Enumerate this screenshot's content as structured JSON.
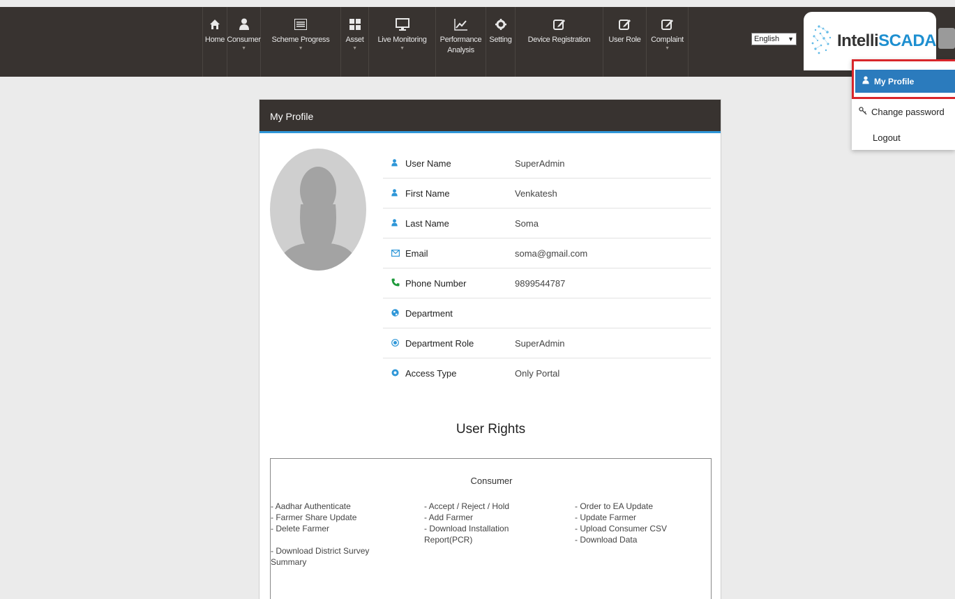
{
  "nav": [
    {
      "label": "Home",
      "icon": "home-icon",
      "caret": false
    },
    {
      "label": "Consumer",
      "icon": "user-icon",
      "caret": true
    },
    {
      "label": "Scheme Progress",
      "icon": "list-icon",
      "caret": true
    },
    {
      "label": "Asset",
      "icon": "grid-icon",
      "caret": true
    },
    {
      "label": "Live Monitoring",
      "icon": "monitor-icon",
      "caret": true
    },
    {
      "label": "Performance Analysis",
      "icon": "chart-icon",
      "caret": false
    },
    {
      "label": "Setting",
      "icon": "gear-icon",
      "caret": false
    },
    {
      "label": "Device Registration",
      "icon": "edit-icon",
      "caret": false
    },
    {
      "label": "User Role",
      "icon": "edit-icon",
      "caret": false
    },
    {
      "label": "Complaint",
      "icon": "edit-icon",
      "caret": true
    }
  ],
  "language": {
    "selected": "English"
  },
  "logo": {
    "part1": "Intelli",
    "part2": "SCADA"
  },
  "menu": {
    "my_profile": "My Profile",
    "change_password": "Change password",
    "logout": "Logout"
  },
  "panel": {
    "title": "My Profile"
  },
  "profile": [
    {
      "label": "User Name",
      "value": "SuperAdmin",
      "icon": "user-icon"
    },
    {
      "label": "First Name",
      "value": "Venkatesh",
      "icon": "user-icon"
    },
    {
      "label": "Last Name",
      "value": "Soma",
      "icon": "user-icon"
    },
    {
      "label": "Email",
      "value": "soma@gmail.com",
      "icon": "mail-icon"
    },
    {
      "label": "Phone Number",
      "value": "9899544787",
      "icon": "phone-icon"
    },
    {
      "label": "Department",
      "value": "",
      "icon": "globe-icon"
    },
    {
      "label": "Department Role",
      "value": "SuperAdmin",
      "icon": "target-icon"
    },
    {
      "label": "Access Type",
      "value": "Only Portal",
      "icon": "cog-icon"
    }
  ],
  "rights": {
    "title": "User Rights",
    "section": "Consumer",
    "col1": [
      "- Aadhar Authenticate",
      "- Farmer Share Update",
      "- Delete Farmer",
      "",
      "- Download District Survey Summary"
    ],
    "col2": [
      "- Accept / Reject / Hold",
      "- Add Farmer",
      "- Download Installation Report(PCR)"
    ],
    "col3": [
      "- Order to EA Update",
      "- Update Farmer",
      "- Upload Consumer CSV",
      "- Download Data"
    ]
  },
  "colors": {
    "topbar": "#383330",
    "accent": "#2f97d8",
    "active_menu": "#2b7bbd",
    "highlight": "#d8262b",
    "icon_blue": "#2f97d8",
    "phone_green": "#1e9a3b"
  }
}
